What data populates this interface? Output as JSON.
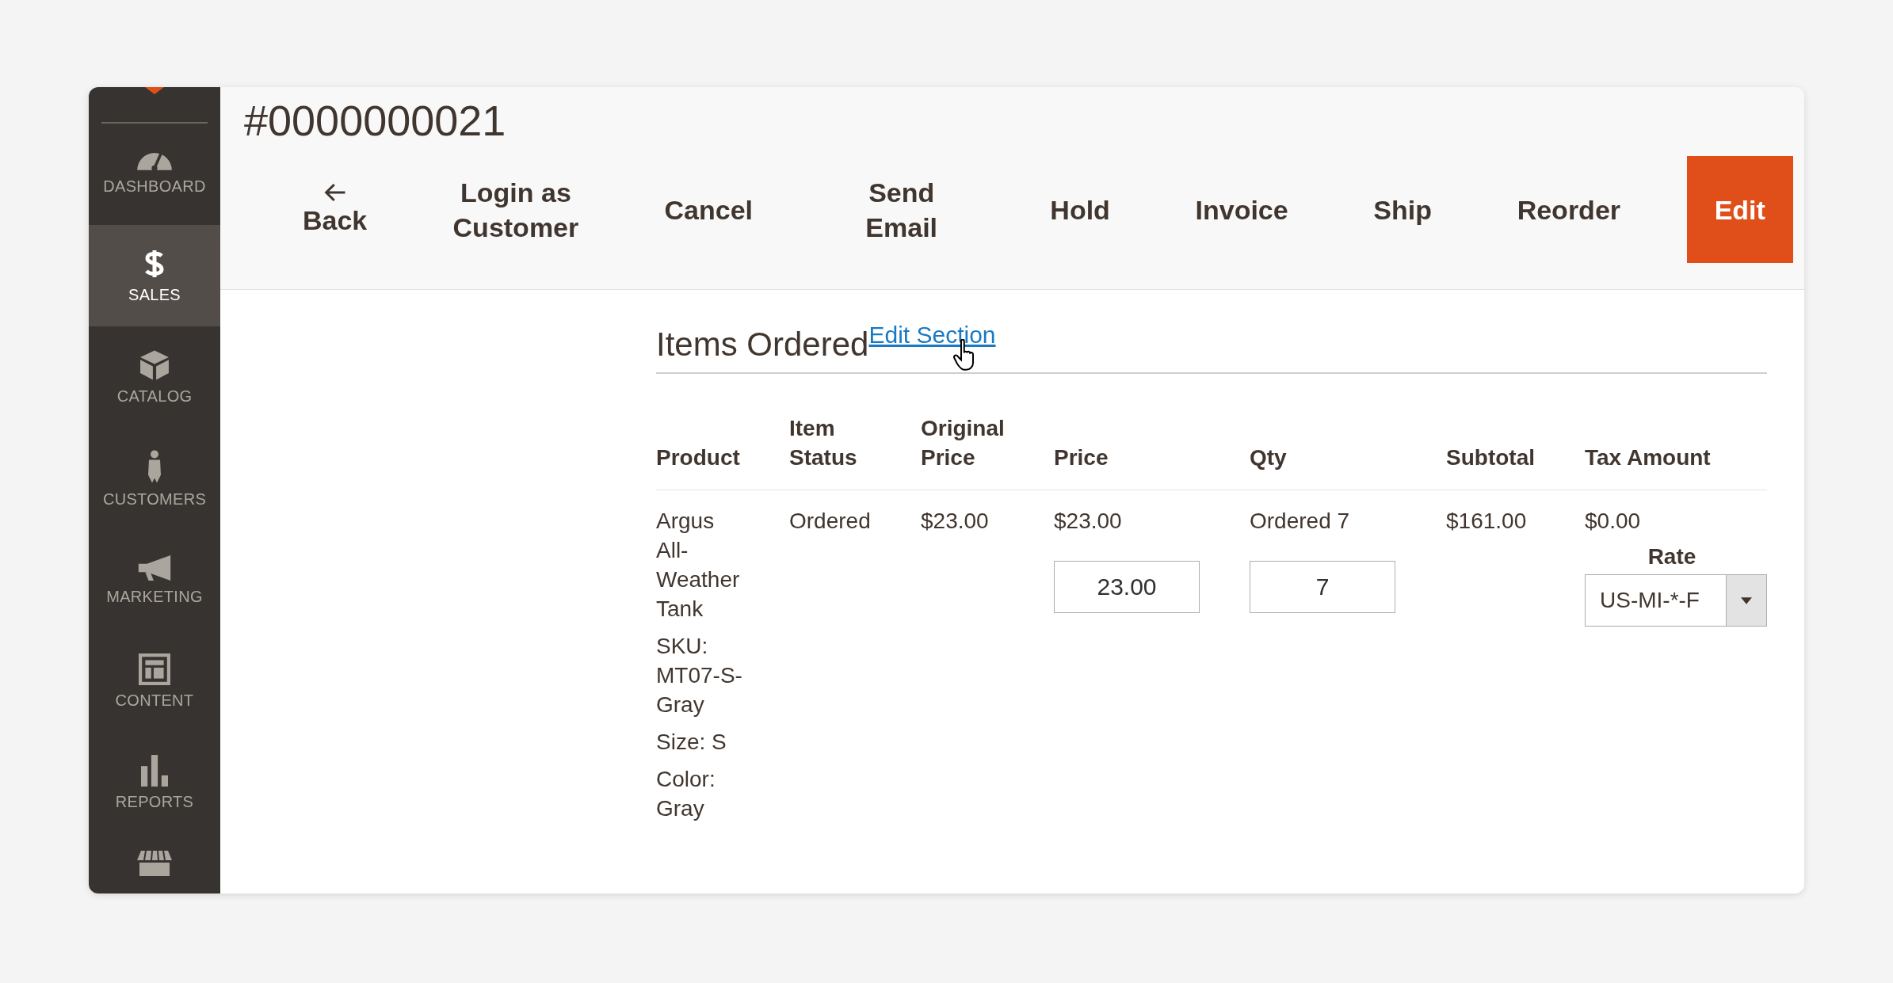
{
  "sidebar": {
    "items": [
      {
        "label": "DASHBOARD",
        "selected": false
      },
      {
        "label": "SALES",
        "selected": true
      },
      {
        "label": "CATALOG",
        "selected": false
      },
      {
        "label": "CUSTOMERS",
        "selected": false
      },
      {
        "label": "MARKETING",
        "selected": false
      },
      {
        "label": "CONTENT",
        "selected": false
      },
      {
        "label": "REPORTS",
        "selected": false
      }
    ]
  },
  "page_title": "#0000000021",
  "toolbar": [
    {
      "label": "Back",
      "kind": "back"
    },
    {
      "label": "Login as Customer",
      "kind": "plain"
    },
    {
      "label": "Cancel",
      "kind": "plain"
    },
    {
      "label": "Send Email",
      "kind": "plain"
    },
    {
      "label": "Hold",
      "kind": "plain"
    },
    {
      "label": "Invoice",
      "kind": "plain"
    },
    {
      "label": "Ship",
      "kind": "plain"
    },
    {
      "label": "Reorder",
      "kind": "plain"
    },
    {
      "label": "Edit",
      "kind": "primary"
    }
  ],
  "section": {
    "title": "Items Ordered",
    "link": "Edit Section"
  },
  "table": {
    "columns": [
      "Product",
      "Item Status",
      "Original Price",
      "Price",
      "Qty",
      "Subtotal",
      "Tax Amount"
    ],
    "rows": [
      {
        "product": {
          "name": "Argus All-Weather Tank",
          "sku": "SKU: MT07-S-Gray",
          "options": [
            "Size: S",
            "Color: Gray"
          ]
        },
        "status": "Ordered",
        "original_price": "$23.00",
        "price": "$23.00",
        "price_input": "23.00",
        "qty": "Ordered 7",
        "qty_input": "7",
        "subtotal": "$161.00",
        "tax": "$0.00",
        "rate_label": "Rate",
        "rate_value": "US-MI-*-F"
      }
    ]
  }
}
